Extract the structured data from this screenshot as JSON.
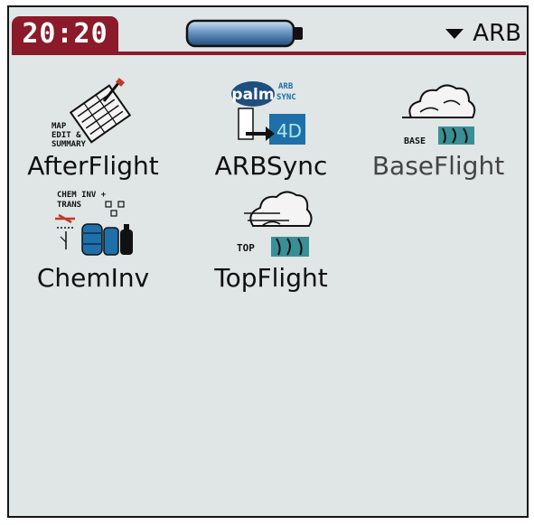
{
  "status": {
    "time": "20:20",
    "category": "ARB"
  },
  "apps": [
    {
      "name": "AfterFlight",
      "icon": "map-edit-summary-icon",
      "icon_text": [
        "MAP",
        "EDIT &",
        "SUMMARY"
      ]
    },
    {
      "name": "ARBSync",
      "icon": "palm-arb-sync-icon",
      "icon_text": [
        "palm",
        "ARB",
        "SYNC",
        "4D"
      ]
    },
    {
      "name": "BaseFlight",
      "icon": "base-cloud-icon",
      "icon_text": [
        "BASE"
      ]
    },
    {
      "name": "ChemInv",
      "icon": "chem-inv-trans-icon",
      "icon_text": [
        "CHEM INV +",
        "TRANS"
      ]
    },
    {
      "name": "TopFlight",
      "icon": "top-cloud-icon",
      "icon_text": [
        "TOP"
      ]
    }
  ],
  "colors": {
    "screen": "#dfe6e5",
    "status_bar": "#8b1a2a",
    "battery": "#2f5a88",
    "icon_blue": "#1f6fa8",
    "icon_teal": "#3a8f97"
  }
}
